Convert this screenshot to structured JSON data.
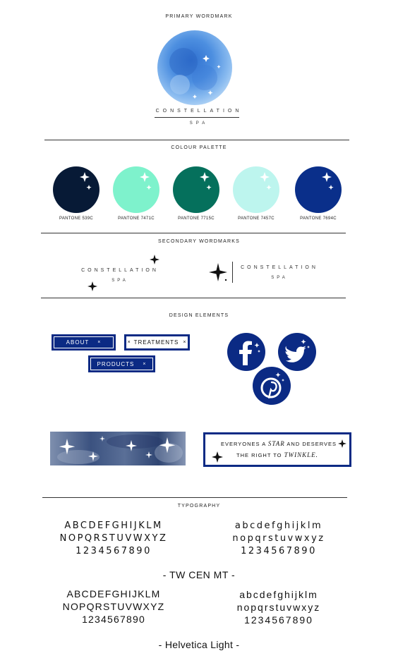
{
  "primary_wordmark": {
    "title": "PRIMARY WORDMARK",
    "name": "CONSTELLATION",
    "sub": "SPA"
  },
  "colour_palette": {
    "title": "COLOUR PALETTE",
    "swatches": [
      {
        "label": "PANTONE 539C",
        "color": "#071a36"
      },
      {
        "label": "PANTONE 7471C",
        "color": "#7ef2cc"
      },
      {
        "label": "PANTONE 7715C",
        "color": "#05705c"
      },
      {
        "label": "PANTONE 7457C",
        "color": "#bdf5ee"
      },
      {
        "label": "PANTONE 7694C",
        "color": "#0a2f8a"
      }
    ]
  },
  "secondary_wordmarks": {
    "title": "SECONDARY WORDMARKS",
    "left_name": "CONSTELLATION",
    "left_sub": "SPA",
    "right_name": "CONSTELLATION",
    "right_sub": "SPA"
  },
  "design_elements": {
    "title": "DESIGN ELEMENTS",
    "buttons": {
      "about": "ABOUT",
      "treatments": "TREATMENTS",
      "products": "PRODUCTS",
      "close_glyph": "×"
    },
    "quote": {
      "line1_a": "EVERYONES A ",
      "line1_em": "STAR",
      "line1_b": " AND DESERVES",
      "line2_a": "THE RIGHT TO ",
      "line2_em": "TWINKLE."
    }
  },
  "typography": {
    "title": "TYPOGRAPHY",
    "font1": {
      "upper1": "ABCDEFGHIJKLM",
      "upper2": "NOPQRSTUVWXYZ",
      "nums": "1234567890",
      "lower1": "abcdefghijklm",
      "lower2": "nopqrstuvwxyz",
      "lnums": "1234567890",
      "name": "- TW CEN MT -"
    },
    "font2": {
      "upper1": "ABCDEFGHIJKLM",
      "upper2": "NOPQRSTUVWXYZ",
      "nums": "1234567890",
      "lower1": "abcdefghijklm",
      "lower2": "nopqrstuvwxyz",
      "lnums": "1234567890",
      "name": "- Helvetica Light -"
    }
  },
  "colors": {
    "navy": "#0b2a84",
    "watercolor": "#3b7fd4"
  }
}
